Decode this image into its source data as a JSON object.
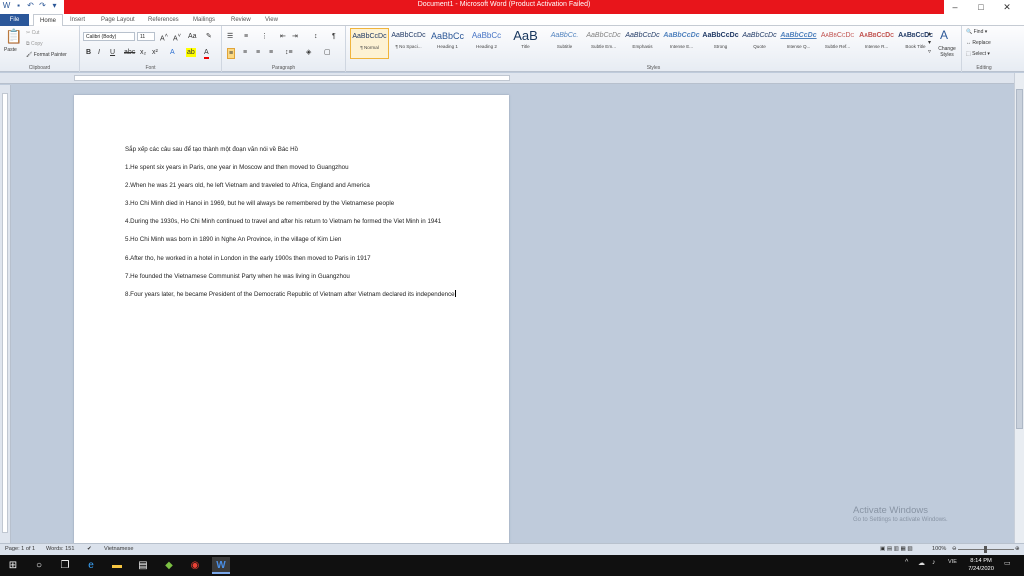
{
  "window": {
    "title": "Document1 - Microsoft Word (Product Activation Failed)",
    "controls": [
      "–",
      "□",
      "✕"
    ]
  },
  "tabs": [
    "File",
    "Home",
    "Insert",
    "Page Layout",
    "References",
    "Mailings",
    "Review",
    "View"
  ],
  "ribbon": {
    "clipboard": {
      "label": "Clipboard",
      "paste": "Paste",
      "cut": "Cut",
      "copy": "Copy",
      "format_painter": "Format Painter"
    },
    "font": {
      "label": "Font",
      "name": "Calibri (Body)",
      "size": "11"
    },
    "paragraph": {
      "label": "Paragraph"
    },
    "styles": {
      "label": "Styles",
      "items": [
        {
          "sample": "AaBbCcDc",
          "name": "¶ Normal"
        },
        {
          "sample": "AaBbCcDc",
          "name": "¶ No Spaci..."
        },
        {
          "sample": "AaBbCc",
          "name": "Heading 1"
        },
        {
          "sample": "AaBbCc",
          "name": "Heading 2"
        },
        {
          "sample": "AaB",
          "name": "Title"
        },
        {
          "sample": "AaBbCc.",
          "name": "Subtitle"
        },
        {
          "sample": "AaBbCcDc",
          "name": "Subtle Em..."
        },
        {
          "sample": "AaBbCcDc",
          "name": "Emphasis"
        },
        {
          "sample": "AaBbCcDc",
          "name": "Intense E..."
        },
        {
          "sample": "AaBbCcDc",
          "name": "Strong"
        },
        {
          "sample": "AaBbCcDc",
          "name": "Quote"
        },
        {
          "sample": "AaBbCcDc",
          "name": "Intense Q..."
        },
        {
          "sample": "AaBbCcDc",
          "name": "Subtle Ref..."
        },
        {
          "sample": "AaBbCcDc",
          "name": "Intense R..."
        },
        {
          "sample": "AaBbCcDc",
          "name": "Book Title"
        }
      ],
      "change_styles": "Change Styles"
    },
    "editing": {
      "label": "Editing",
      "find": "Find",
      "replace": "Replace",
      "select": "Select"
    }
  },
  "document": {
    "paragraphs": [
      "Sắp xếp các câu sau để tạo thành một đoạn văn nói về Bác Hồ",
      "1.He spent six years in Paris, one year in Moscow and then moved to Guangzhou",
      "2.When he was 21 years old, he left Vietnam and traveled to Africa, England and America",
      "3.Ho Chi Minh died in Hanoi in 1969, but he will always be remembered by the Vietnamese people",
      "4.During the 1930s, Ho Chi Minh continued to travel and after his return to Vietnam he formed the Viet Minh in 1941",
      "5.Ho Chi Minh was born in 1890 in Nghe An Province, in the village of Kim Lien",
      "6.After tho, he worked in a hotel in London in the early 1900s then moved to Paris in 1917",
      "7.He founded the Vietnamese Communist Party when he was living in Guangzhou",
      "8.Four years later, he became President of the Democratic Republic of Vietnam after Vietnam declared its independence"
    ]
  },
  "watermark": {
    "heading": "Activate Windows",
    "sub": "Go to Settings to activate Windows."
  },
  "status": {
    "page": "Page: 1 of 1",
    "words": "Words: 151",
    "language": "Vietnamese",
    "zoom": "100%"
  },
  "taskbar": {
    "time": "8:14 PM",
    "date": "7/24/2020",
    "lang": "VIE"
  }
}
